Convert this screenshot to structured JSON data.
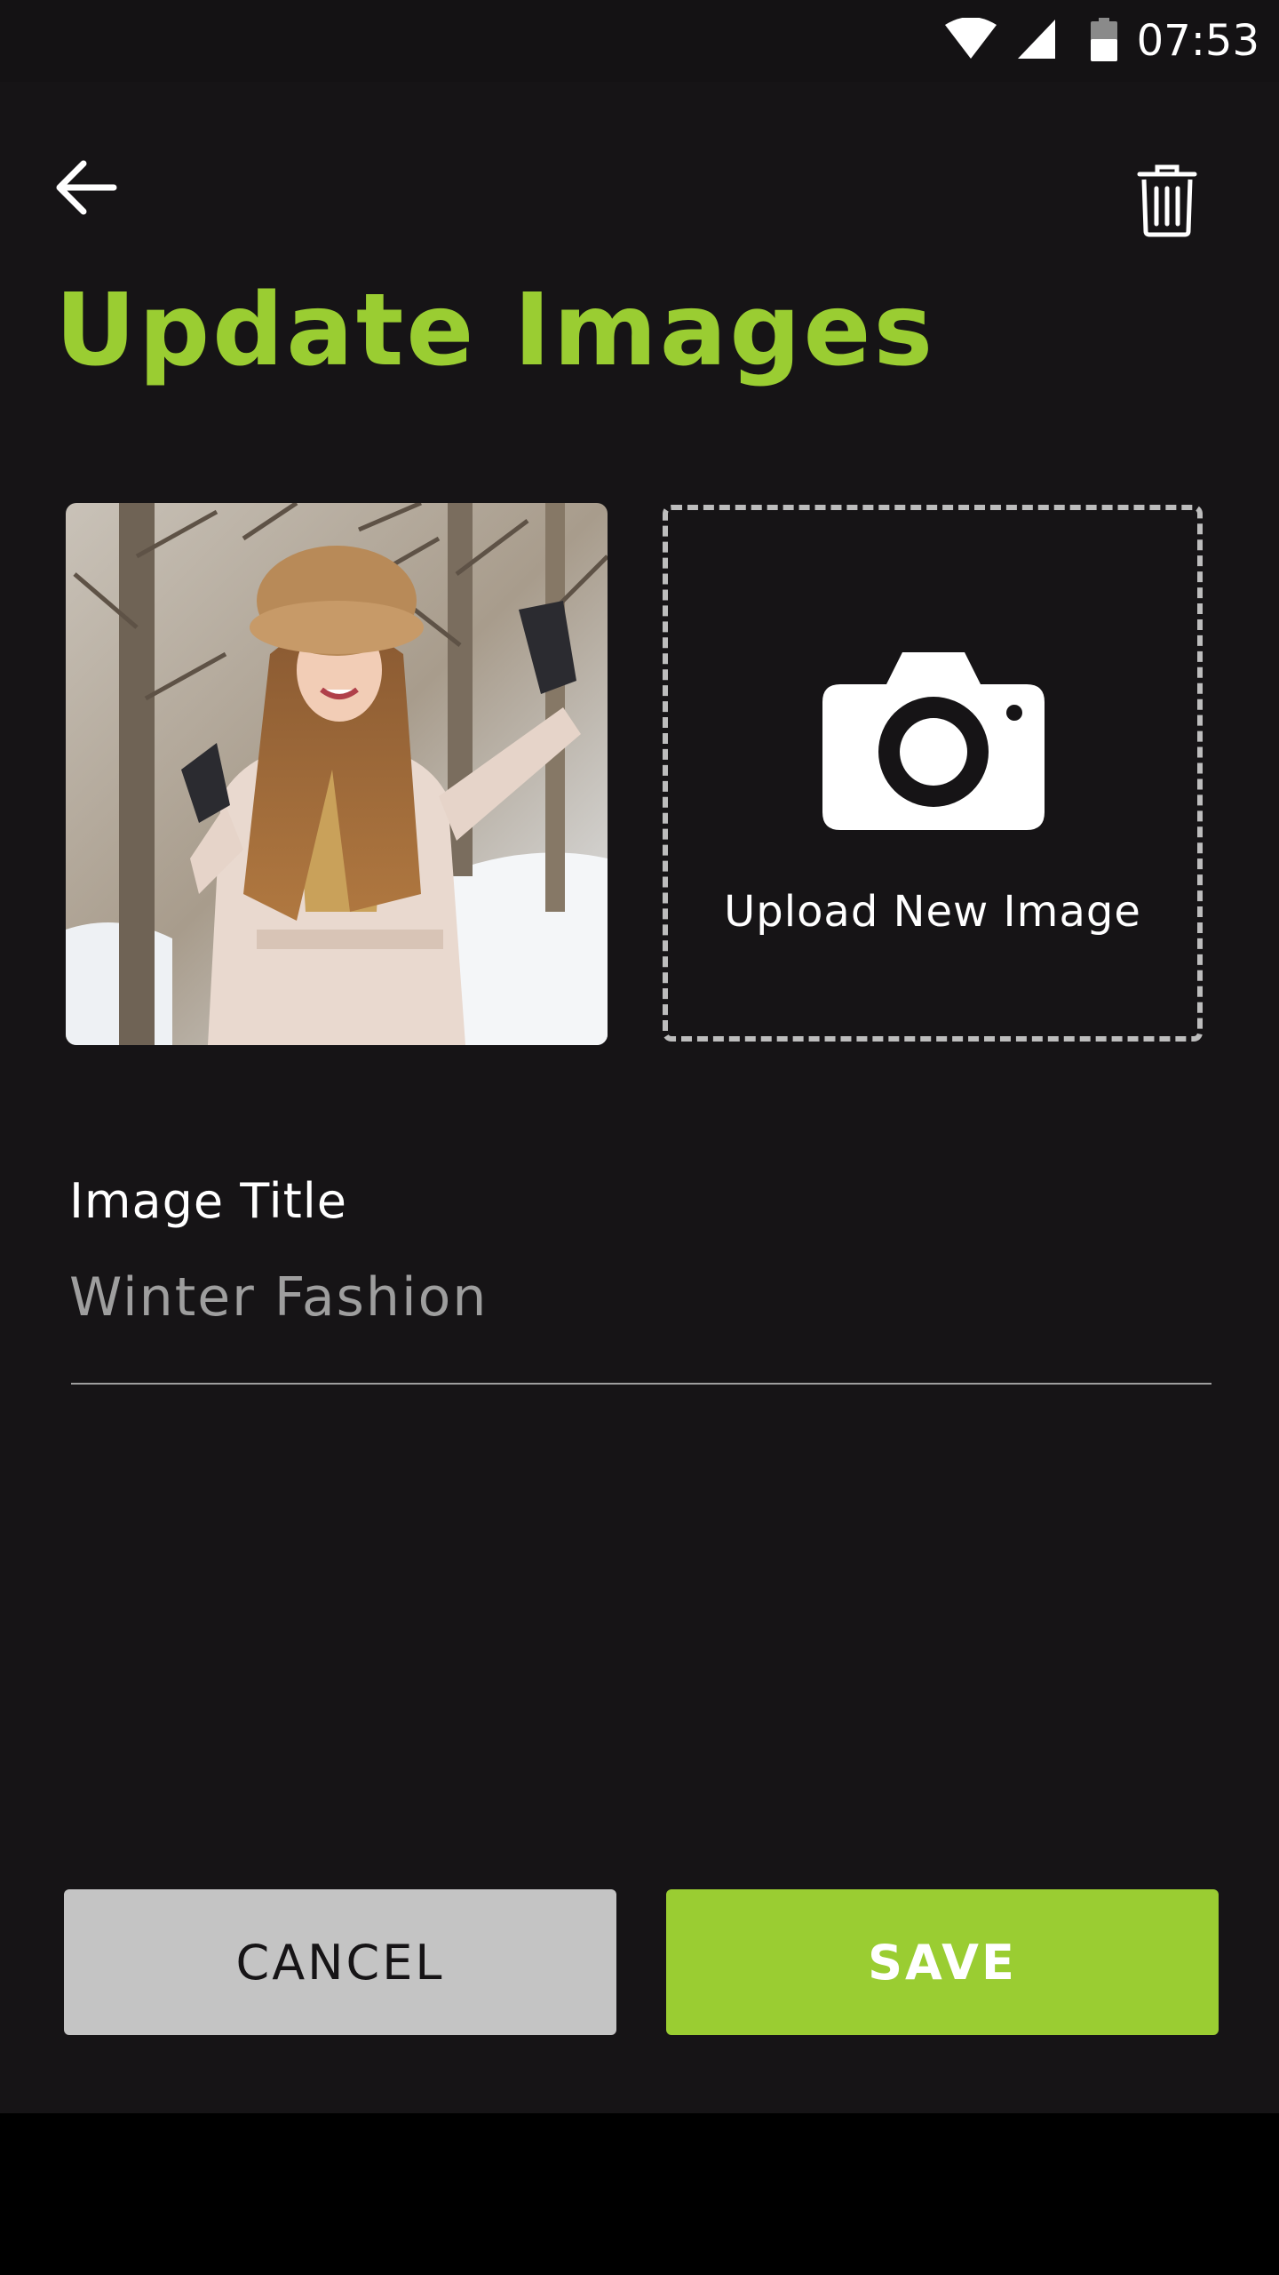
{
  "status_bar": {
    "time": "07:53",
    "icons": [
      "wifi-icon",
      "cell-signal-icon",
      "battery-icon"
    ]
  },
  "header": {
    "back_icon": "arrow-left-icon",
    "delete_icon": "trash-icon",
    "title": "Update Images"
  },
  "images": {
    "current_image_alt": "Woman in fur hat and winter coat in snowy forest",
    "upload_label": "Upload New Image",
    "upload_icon": "camera-icon"
  },
  "form": {
    "title_label": "Image Title",
    "title_value": "Winter Fashion"
  },
  "actions": {
    "cancel_label": "CANCEL",
    "save_label": "SAVE"
  },
  "colors": {
    "background": "#161416",
    "accent": "#9ACD32",
    "cancel_bg": "#C4C4C4",
    "text_primary": "#FFFFFF",
    "text_secondary": "#9E9E9E"
  }
}
